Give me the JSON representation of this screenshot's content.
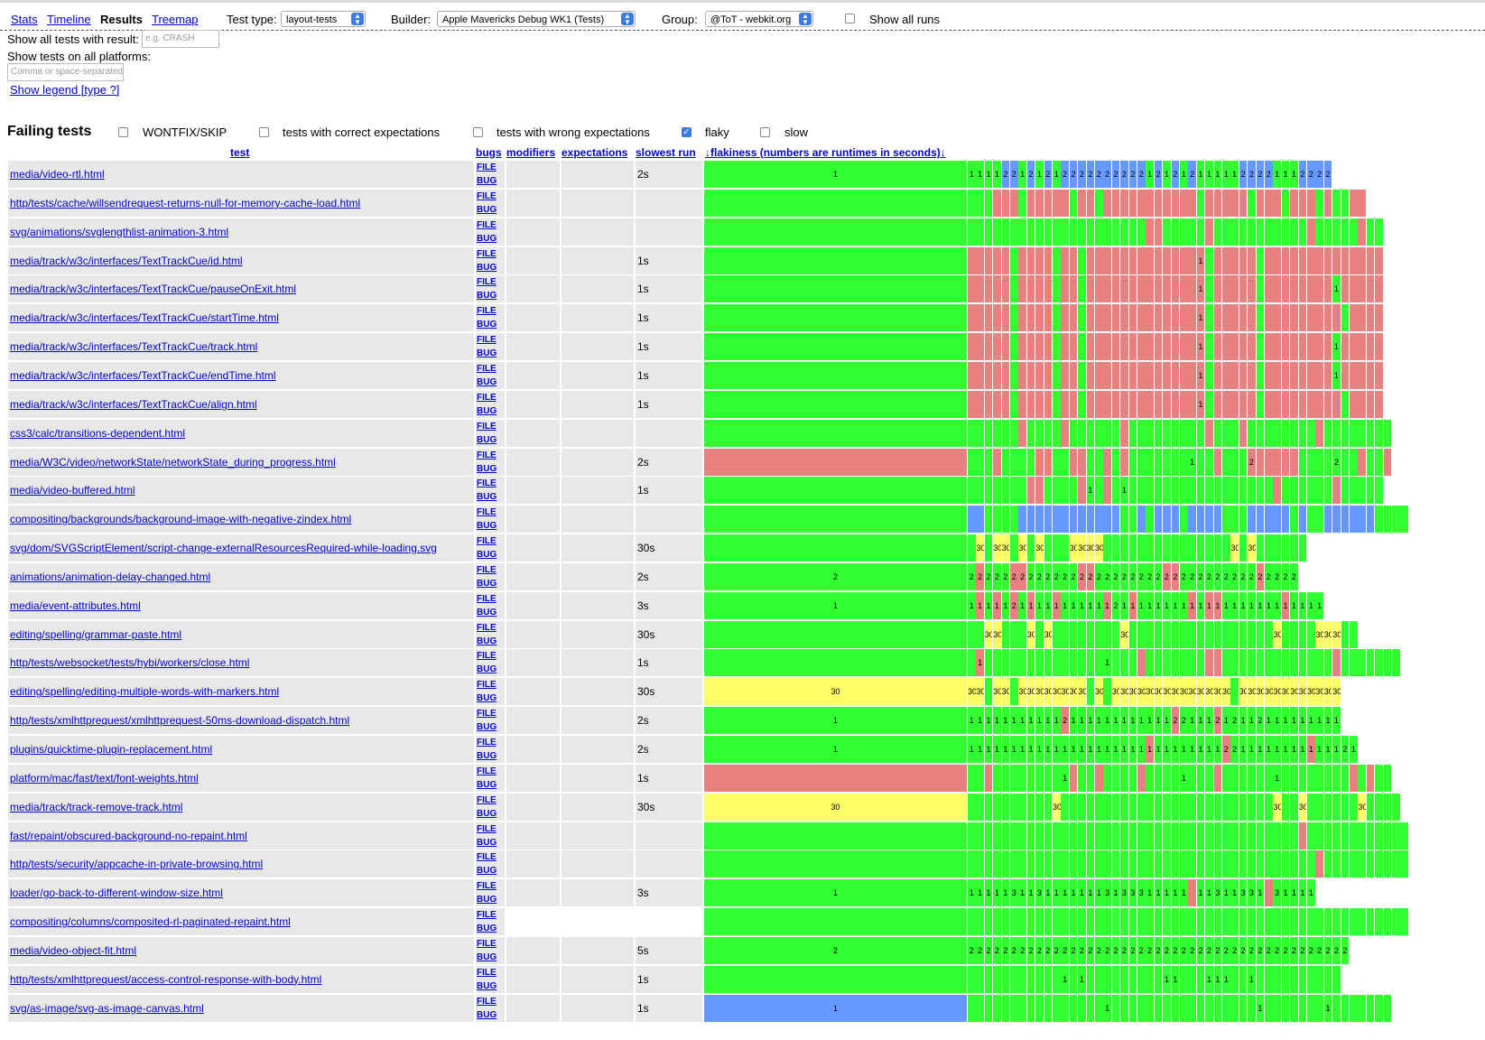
{
  "nav": {
    "stats": "Stats",
    "timeline": "Timeline",
    "results": "Results",
    "treemap": "Treemap"
  },
  "filters": {
    "test_type_label": "Test type:",
    "test_type_value": "layout-tests",
    "builder_label": "Builder:",
    "builder_value": "Apple Mavericks Debug WK1 (Tests)",
    "group_label": "Group:",
    "group_value": "@ToT - webkit.org",
    "show_all_runs": "Show all runs",
    "show_result_label": "Show all tests with result:",
    "show_result_placeholder": "e.g. CRASH",
    "platforms_label": "Show tests on all platforms:",
    "platforms_placeholder": "Comma or space-separated",
    "legend_link": "Show legend [type ?]"
  },
  "failing": {
    "title": "Failing tests",
    "options": [
      {
        "label": "WONTFIX/SKIP",
        "checked": false
      },
      {
        "label": "tests with correct expectations",
        "checked": false
      },
      {
        "label": "tests with wrong expectations",
        "checked": false
      },
      {
        "label": "flaky",
        "checked": true
      },
      {
        "label": "slow",
        "checked": false
      }
    ]
  },
  "columns": {
    "test": "test",
    "bugs": "bugs",
    "modifiers": "modifiers",
    "expectations": "expectations",
    "slowest": "slowest run",
    "flakiness": "↓flakiness (numbers are runtimes in seconds)↓"
  },
  "bug_labels": {
    "file": "FILE",
    "bug": "BUG"
  },
  "colors": {
    "pass": "#30ff30",
    "fail": "#e88080",
    "missing": "#6699ff",
    "timeout": "#ffff66"
  },
  "rows": [
    {
      "name": "media/video-rtl.html",
      "slowest": "2s",
      "summary": "1",
      "sumc": "g",
      "runs": "1g1g1g1g2b2b1g2b1g2b1g2b2b2b2b2b2b2b2b2b2b1g2b1g2b1g2b1g1g1g1g1g2b2b2b2b1g1g1g2b2b2b2b"
    },
    {
      "name": "http/tests/cache/willsendrequest-returns-null-for-memory-cache-load.html",
      "slowest": "",
      "summary": "",
      "sumc": "g",
      "runs": "gggrrrgrrrrrgrrgrrrrrrrrrrrgrrrrrgrrrgrrrgrggrr"
    },
    {
      "name": "svg/animations/svglengthlist-animation-3.html",
      "slowest": "",
      "summary": "",
      "sumc": "g",
      "runs": "gggggggggggggggggggggrrgggggrgggggggggggrgggggrgg"
    },
    {
      "name": "media/track/w3c/interfaces/TextTrackCue/id.html",
      "slowest": "1s",
      "summary": "",
      "sumc": "g",
      "runs": "rrrrrgrrrrgrrgrrrrrrrrrrrrr1rgrrrrrgrrrrrrrrrrrrrr"
    },
    {
      "name": "media/track/w3c/interfaces/TextTrackCue/pauseOnExit.html",
      "slowest": "1s",
      "summary": "",
      "sumc": "g",
      "runs": "rrrrrgrrrrgrrgrrrrrrrrrrrrr1rgrrrrrgrrrrrrrr1grrrrr"
    },
    {
      "name": "media/track/w3c/interfaces/TextTrackCue/startTime.html",
      "slowest": "1s",
      "summary": "",
      "sumc": "g",
      "runs": "rrrrrgrrrrgrrgrrrrrrrrrrrrr1rgrrrrrgrrrrrrrrrgrrrr"
    },
    {
      "name": "media/track/w3c/interfaces/TextTrackCue/track.html",
      "slowest": "1s",
      "summary": "",
      "sumc": "g",
      "runs": "rrrrrgrrrrgrrgrrrrrrrrrrrrr1rgrrrrrgrrrrrrrr1grrrrr"
    },
    {
      "name": "media/track/w3c/interfaces/TextTrackCue/endTime.html",
      "slowest": "1s",
      "summary": "",
      "sumc": "g",
      "runs": "rrrrrgrrrrgrrgrrrrrrrrrrrrr1rgrrrrrgrrrrrrrr1grrrrr"
    },
    {
      "name": "media/track/w3c/interfaces/TextTrackCue/align.html",
      "slowest": "1s",
      "summary": "",
      "sumc": "g",
      "runs": "rrrrrgrrrrgrrgrrrrrrrrrrrrr1rgrrrrrgrrrrrrrrrgrrrr"
    },
    {
      "name": "css3/calc/transitions-dependent.html",
      "slowest": "",
      "summary": "",
      "sumc": "g",
      "runs": "ggggggrggggrggggggrgggggggggrgggrggggggggrgggggggg"
    },
    {
      "name": "media/W3C/video/networkState/networkState_during_progress.html",
      "slowest": "2s",
      "summary": "",
      "sumc": "r",
      "runs": "gggrggggrrggrrggrgrggggggg1gggrggg2rrrrrrgggg2gggrggr"
    },
    {
      "name": "media/video-buffered.html",
      "slowest": "1s",
      "summary": "",
      "sumc": "g",
      "runs": "gggggggrrggggr1ggrg1ggggggggggggggggggrggggggrggggg"
    },
    {
      "name": "compositing/backgrounds/background-image-with-negative-zindex.html",
      "slowest": "",
      "summary": "",
      "sumc": "g",
      "runs": "bbggggbbbbbbbbbbbbggbgbbbgbbbbgggbbbbbgbggbbbbbbgggg"
    },
    {
      "name": "svg/dom/SVGScriptElement/script-change-externalResourcesRequired-while-loading.svg",
      "slowest": "30s",
      "summary": "",
      "sumc": "g",
      "runs": "g30yg30y30yg30yg30yggg30y30y30y30yggggggggggggggg30yg30ygggggg"
    },
    {
      "name": "animations/animation-delay-changed.html",
      "slowest": "2s",
      "summary": "2",
      "sumc": "g",
      "runs": "2g2r2g2g2g2r2r2g2g2g2g2g2g2r2r2g2g2g2g2g2g2g2g2r2r2g2g2g2g2g2g2g2g2g2r2g2g2g2g"
    },
    {
      "name": "media/event-attributes.html",
      "slowest": "3s",
      "summary": "1",
      "sumc": "g",
      "runs": "1g1r1g1r1g2r1g1r1g1g1r1g1g1g1g1g1r2g1g1r1g1g1g1g1g1g1r1g1r1r1g1g1g1g1g1g1g1r1g1g1g1g"
    },
    {
      "name": "editing/spelling/grammar-paste.html",
      "slowest": "30s",
      "summary": "",
      "sumc": "g",
      "runs": "gg30y30yggg30yg30ygggggggg30yggggggggggggggggg30ygggg30y30y30ygg"
    },
    {
      "name": "http/tests/websocket/tests/hybi/workers/close.html",
      "slowest": "1s",
      "summary": "",
      "sumc": "g",
      "runs": "g1rgggggggggggggg1ggggrgggggggrrgggggggggggggrggggggg"
    },
    {
      "name": "editing/spelling/editing-multiple-words-with-markers.html",
      "slowest": "30s",
      "summary": "30",
      "sumc": "y",
      "runs": "30y30yg30y30yg30y30y30y30y30y30y30y30yg30yg30y30y30y30y30y30y30y30y30y30y30y30y30y30yg30y30y30y30y30y30y30y30y30y30y30y30y"
    },
    {
      "name": "http/tests/xmlhttprequest/xmlhttprequest-50ms-download-dispatch.html",
      "slowest": "2s",
      "summary": "1",
      "sumc": "g",
      "runs": "1g1g1g1g1g1g1g1g1g1g1g2r1g1g1g1g1g1g1g1g1g1g1g1g2r2g1g1g1g2r1g2g1g1g2g1g1g1g1g1g1g1g1g1g"
    },
    {
      "name": "plugins/quicktime-plugin-replacement.html",
      "slowest": "2s",
      "summary": "1",
      "sumc": "g",
      "runs": "1g1g1g1g1g1g1g1g1g1g1g1g1g1g1g1g1g1g1g1g1g1r1g1g1g1g1g1g1g1g2r2g1g1g1g1g1g1g1g1g1r1g1g1g2g1g"
    },
    {
      "name": "platform/mac/fast/text/font-weights.html",
      "slowest": "1s",
      "summary": "",
      "sumc": "r",
      "runs": "ggrgggggggg1grggrggggrgggg1ggggrgggggg1gggggggggrgrgg"
    },
    {
      "name": "media/track/track-remove-track.html",
      "slowest": "30s",
      "summary": "30",
      "sumc": "y",
      "runs": "gggggggggg30yggggggggggggggggggggggggg30ygg30ygggggg30ygggg"
    },
    {
      "name": "fast/repaint/obscured-background-no-repaint.html",
      "slowest": "",
      "summary": "",
      "sumc": "g",
      "runs": "gggggggggggggggggggggggggggggggggggggggrgggggggggggg"
    },
    {
      "name": "http/tests/security/appcache-in-private-browsing.html",
      "slowest": "",
      "summary": "",
      "sumc": "g",
      "runs": "gggggggggggggggggggggggggggggggggggggggggrgggggggggg"
    },
    {
      "name": "loader/go-back-to-different-window-size.html",
      "slowest": "3s",
      "summary": "1",
      "sumc": "g",
      "runs": "1g1g1g1g1g3g1g1g3g1g1g1g1g1g1g1g3g1g3g3g3g1g1g1g1g1gr1g1g3g1g1g3g3g1gr3g1g1g1g1g"
    },
    {
      "name": "compositing/columns/composited-rl-paginated-repaint.html",
      "slowest": "",
      "summary": "",
      "sumc": "g",
      "runs": "gggggggggggggggggggggggggggggggggggggggggggggggggggg",
      "blank": true
    },
    {
      "name": "media/video-object-fit.html",
      "slowest": "5s",
      "summary": "2",
      "sumc": "g",
      "runs": "2g2g2g2g2g2g2g2g2g2g2g2g2g2g2g2g2g2g2g2g2g2g2g2g2g2g2g2g2g2g2g2g2g2g2g2g2g2g2g2g2g2g2g2g2g"
    },
    {
      "name": "http/tests/xmlhttprequest/access-control-response-with-body.html",
      "slowest": "1s",
      "summary": "",
      "sumc": "g",
      "runs": "ggggggggggg1gg1gggggggggg1g1gggg1g1g1ggg1ggggggggggg"
    },
    {
      "name": "svg/as-image/svg-as-image-canvas.html",
      "slowest": "1s",
      "summary": "1",
      "sumc": "b",
      "runs": "gggggggggggggggg1gggggggggggggggggg1gggggggg1gggggggg"
    }
  ]
}
